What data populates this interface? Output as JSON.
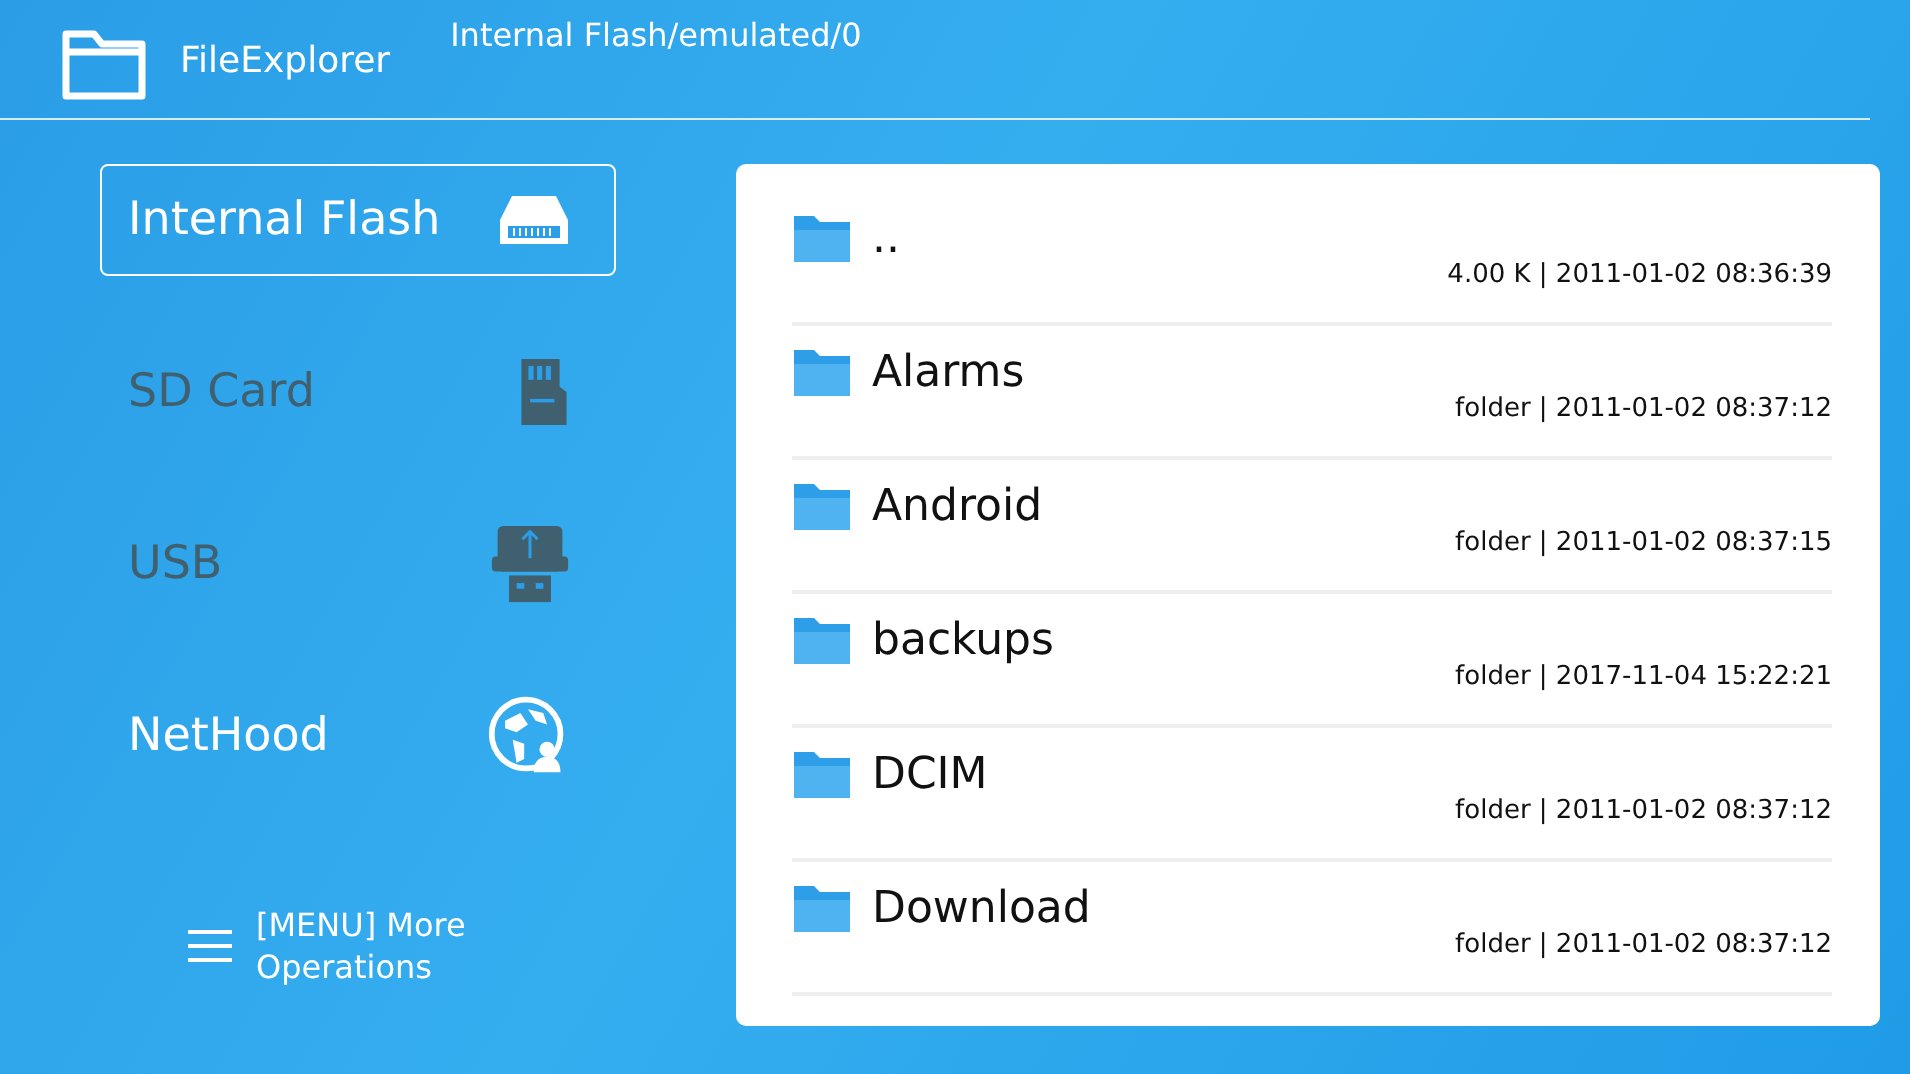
{
  "app": {
    "title": "FileExplorer",
    "path": "Internal Flash/emulated/0"
  },
  "storage": [
    {
      "label": "Internal Flash",
      "kind": "flash",
      "selected": true,
      "disabled": false
    },
    {
      "label": "SD Card",
      "kind": "sdcard",
      "selected": false,
      "disabled": true
    },
    {
      "label": "USB",
      "kind": "usb",
      "selected": false,
      "disabled": true
    },
    {
      "label": "NetHood",
      "kind": "network",
      "selected": false,
      "disabled": false
    }
  ],
  "menu_hint": "[MENU] More Operations",
  "files": [
    {
      "name": "..",
      "info": "4.00 K | 2011-01-02 08:36:39"
    },
    {
      "name": "Alarms",
      "info": "folder | 2011-01-02 08:37:12"
    },
    {
      "name": "Android",
      "info": "folder | 2011-01-02 08:37:15"
    },
    {
      "name": "backups",
      "info": "folder | 2017-11-04 15:22:21"
    },
    {
      "name": "DCIM",
      "info": "folder | 2011-01-02 08:37:12"
    },
    {
      "name": "Download",
      "info": "folder | 2011-01-02 08:37:12"
    }
  ]
}
